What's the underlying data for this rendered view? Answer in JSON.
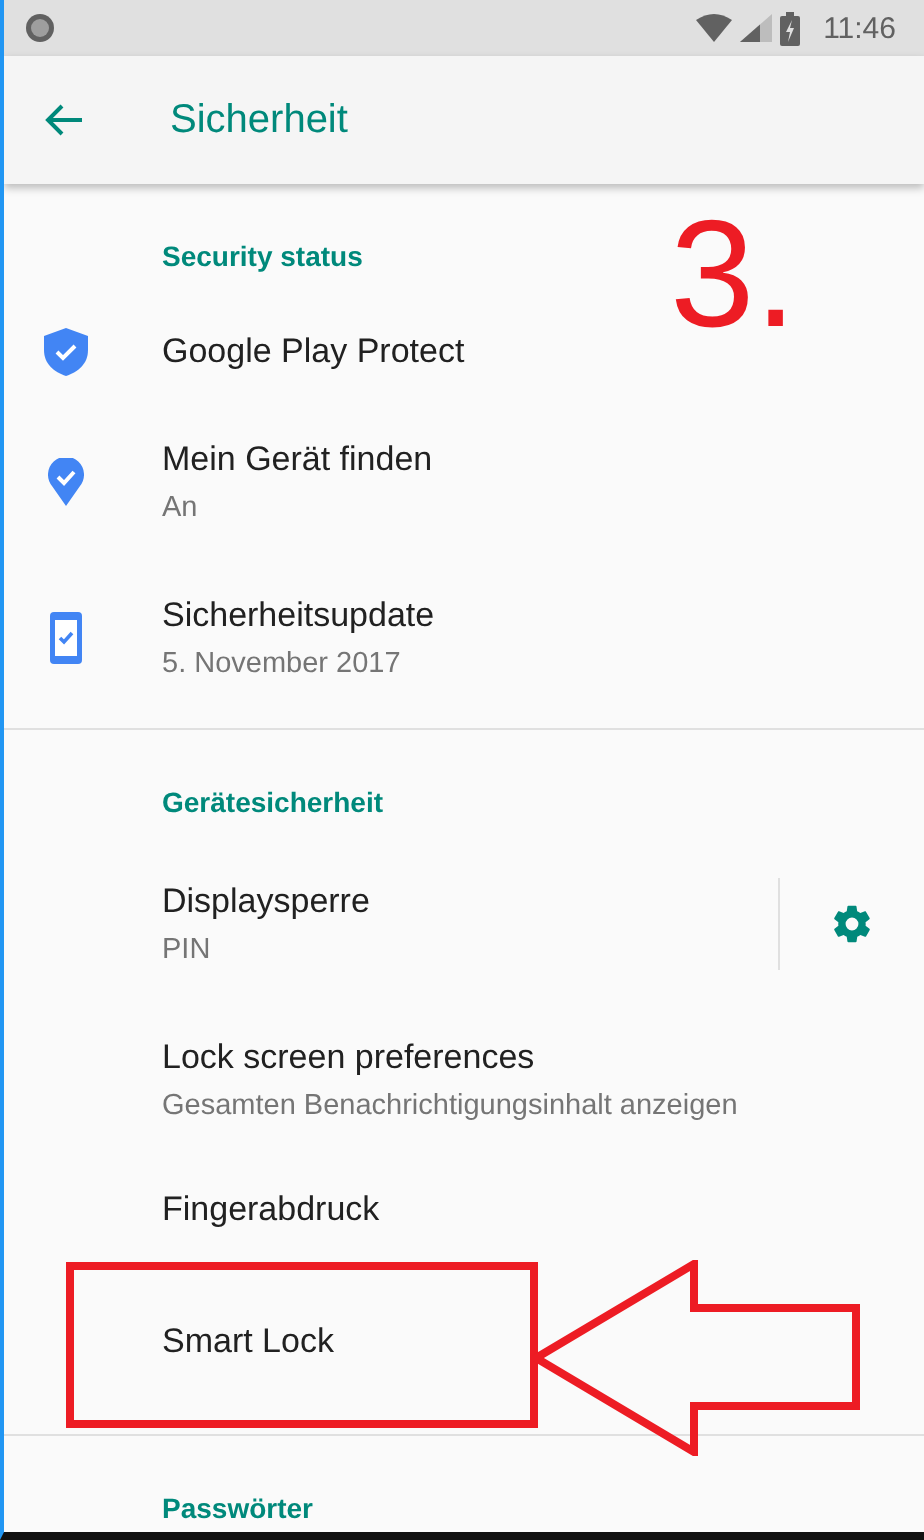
{
  "status_bar": {
    "time": "11:46"
  },
  "app_bar": {
    "title": "Sicherheit"
  },
  "sections": [
    {
      "header": "Security status",
      "items": [
        {
          "title": "Google Play Protect",
          "kind": "icon"
        },
        {
          "title": "Mein Gerät finden",
          "subtitle": "An",
          "kind": "icon"
        },
        {
          "title": "Sicherheitsupdate",
          "subtitle": "5. November 2017",
          "kind": "icon"
        }
      ]
    },
    {
      "header": "Gerätesicherheit",
      "items": [
        {
          "title": "Displaysperre",
          "subtitle": "PIN",
          "kind": "settings"
        },
        {
          "title": "Lock screen preferences",
          "subtitle": "Gesamten Benachrichtigungsinhalt anzeigen"
        },
        {
          "title": "Fingerabdruck"
        },
        {
          "title": "Smart Lock",
          "highlighted": true
        }
      ]
    },
    {
      "header": "Passwörter"
    }
  ],
  "annotation": {
    "step_label": "3."
  }
}
